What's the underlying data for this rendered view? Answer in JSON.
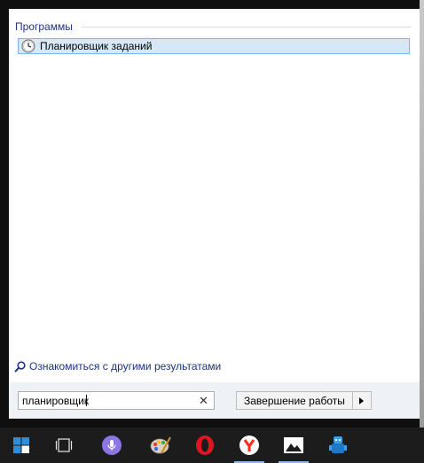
{
  "start_menu": {
    "section_title": "Программы",
    "results": [
      {
        "label": "Планировщик заданий",
        "icon": "clock-icon"
      }
    ],
    "see_more_label": "Ознакомиться с другими результатами",
    "search": {
      "value": "планировщик"
    },
    "clear_icon": "✕",
    "shutdown_label": "Завершение работы",
    "shutdown_arrow": "▶"
  },
  "taskbar": {
    "items": [
      {
        "name": "start",
        "icon": "windows-logo-icon"
      },
      {
        "name": "task-view",
        "icon": "task-view-icon"
      },
      {
        "name": "cortana",
        "icon": "microphone-icon"
      },
      {
        "name": "paint",
        "icon": "paint-palette-icon"
      },
      {
        "name": "opera",
        "icon": "opera-icon"
      },
      {
        "name": "yandex",
        "icon": "yandex-browser-icon"
      },
      {
        "name": "photos",
        "icon": "photos-icon"
      },
      {
        "name": "app",
        "icon": "blue-robot-icon"
      }
    ]
  },
  "colors": {
    "accent": "#1e3287",
    "selection_bg": "#d6e8f7",
    "selection_border": "#7eb4ea",
    "taskbar": "#1c1c1c",
    "start_blue": "#2b8fe0",
    "cortana_purple": "#8d75e6",
    "opera_red": "#e0161e",
    "yandex_red": "#ff2a1a"
  }
}
